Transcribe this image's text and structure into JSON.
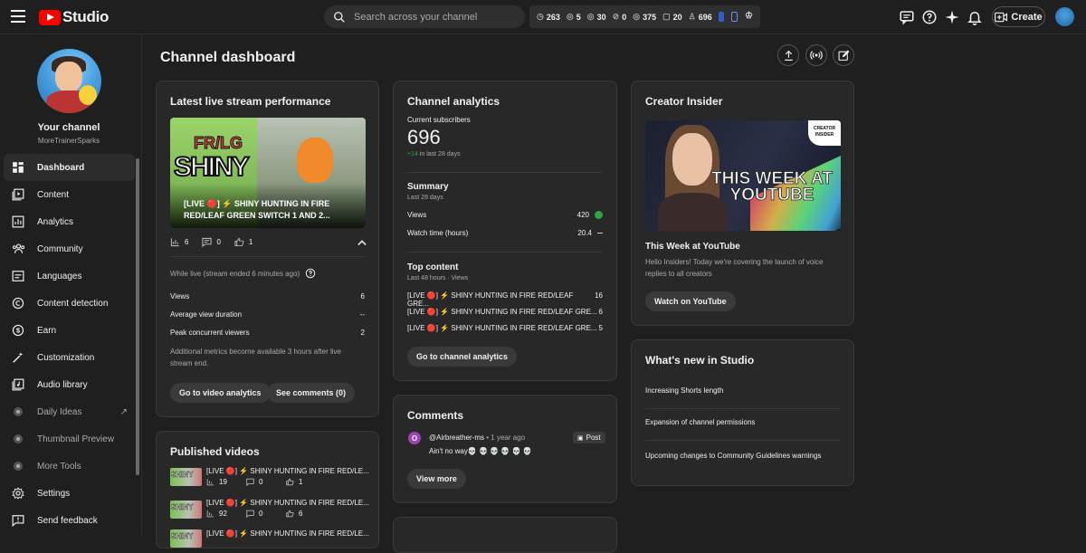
{
  "header": {
    "logo_text": "Studio",
    "search_placeholder": "Search across your channel",
    "stats": [
      {
        "icon": "clock-icon",
        "value": "263"
      },
      {
        "icon": "eye-icon",
        "value": "5"
      },
      {
        "icon": "eye-icon",
        "value": "30"
      },
      {
        "icon": "thumb-icon",
        "value": "0"
      },
      {
        "icon": "eye-icon",
        "value": "375"
      },
      {
        "icon": "comment-icon",
        "value": "20"
      },
      {
        "icon": "person-icon",
        "value": "696"
      }
    ],
    "create_label": "Create"
  },
  "sidebar": {
    "channel_title": "Your channel",
    "channel_handle": "MoreTrainerSparks",
    "items": [
      {
        "label": "Dashboard",
        "icon": "dashboard-icon",
        "active": true
      },
      {
        "label": "Content",
        "icon": "content-icon"
      },
      {
        "label": "Analytics",
        "icon": "analytics-icon"
      },
      {
        "label": "Community",
        "icon": "community-icon"
      },
      {
        "label": "Languages",
        "icon": "languages-icon"
      },
      {
        "label": "Content detection",
        "icon": "copyright-icon"
      },
      {
        "label": "Earn",
        "icon": "dollar-icon"
      },
      {
        "label": "Customization",
        "icon": "wand-icon"
      },
      {
        "label": "Audio library",
        "icon": "audio-icon"
      },
      {
        "label": "Daily Ideas",
        "icon": "extension-icon"
      },
      {
        "label": "Thumbnail Preview",
        "icon": "extension-icon"
      },
      {
        "label": "More Tools",
        "icon": "extension-icon"
      },
      {
        "label": "Settings",
        "icon": "gear-icon"
      },
      {
        "label": "Send feedback",
        "icon": "feedback-icon"
      }
    ]
  },
  "main": {
    "page_title": "Channel dashboard",
    "live_card": {
      "title": "Latest live stream performance",
      "thumb_title": "[LIVE 🔴] ⚡ SHINY HUNTING IN FIRE RED/LEAF GREEN SWITCH 1 AND 2...",
      "thumb_frlg": "FR/LG",
      "thumb_shiny": "SHINY",
      "stats": {
        "views": "6",
        "comments": "0",
        "likes": "1"
      },
      "status": "While live (stream ended 6 minutes ago)",
      "rows": [
        {
          "label": "Views",
          "value": "6"
        },
        {
          "label": "Average view duration",
          "value": "--"
        },
        {
          "label": "Peak concurrent viewers",
          "value": "2"
        }
      ],
      "note": "Additional metrics become available 3 hours after live stream end.",
      "btn_analytics": "Go to video analytics",
      "btn_comments": "See comments (0)"
    },
    "published": {
      "title": "Published videos",
      "videos": [
        {
          "title": "[LIVE 🔴] ⚡ SHINY HUNTING IN FIRE RED/LE...",
          "views": "19",
          "comments": "0",
          "likes": "1"
        },
        {
          "title": "[LIVE 🔴] ⚡ SHINY HUNTING IN FIRE RED/LE...",
          "views": "92",
          "comments": "0",
          "likes": "6"
        },
        {
          "title": "[LIVE 🔴] ⚡ SHINY HUNTING IN FIRE RED/LE..."
        }
      ]
    },
    "analytics": {
      "title": "Channel analytics",
      "subs_label": "Current subscribers",
      "subs_value": "696",
      "subs_change": "+14",
      "subs_change_suffix": "in last 28 days",
      "summary_title": "Summary",
      "summary_sub": "Last 28 days",
      "summary_rows": [
        {
          "label": "Views",
          "value": "420"
        },
        {
          "label": "Watch time (hours)",
          "value": "20.4"
        }
      ],
      "top_title": "Top content",
      "top_sub": "Last 48 hours · Views",
      "top_rows": [
        {
          "label": "[LIVE 🔴] ⚡ SHINY HUNTING IN FIRE RED/LEAF GRE...",
          "value": "16"
        },
        {
          "label": "[LIVE 🔴] ⚡ SHINY HUNTING IN FIRE RED/LEAF GRE...",
          "value": "6"
        },
        {
          "label": "[LIVE 🔴] ⚡ SHINY HUNTING IN FIRE RED/LEAF GRE...",
          "value": "5"
        }
      ],
      "btn": "Go to channel analytics"
    },
    "comments": {
      "title": "Comments",
      "author": "@Airbreather-ms",
      "time": "• 1 year ago",
      "badge": "Post",
      "avatar_letter": "O",
      "text": "Ain't no way💀 💀 💀 💀 💀 💀",
      "btn": "View more"
    },
    "insider": {
      "title": "Creator Insider",
      "thumb_badge": "CREATOR INSIDER",
      "thumb_headline": "THIS WEEK AT YOUTUBE",
      "video_title": "This Week at YouTube",
      "desc": "Hello Insiders! Today we're covering the launch of voice replies to all creators",
      "btn": "Watch on YouTube"
    },
    "whats_new": {
      "title": "What's new in Studio",
      "items": [
        "Increasing Shorts length",
        "Expansion of channel permissions",
        "Upcoming changes to Community Guidelines warnings"
      ]
    }
  },
  "colors": {
    "accent_red": "#ff0000",
    "positive": "#2ba640"
  }
}
